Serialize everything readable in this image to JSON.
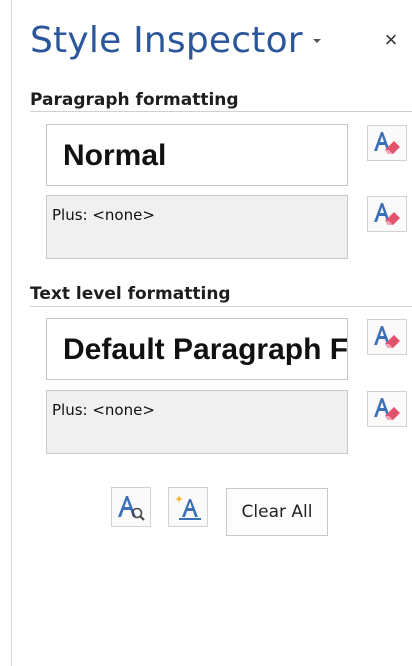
{
  "pane": {
    "title": "Style Inspector",
    "close_label": "×"
  },
  "paragraph": {
    "heading": "Paragraph formatting",
    "style_name": "Normal",
    "plus_text": "Plus: <none>"
  },
  "text_level": {
    "heading": "Text level formatting",
    "style_name": "Default Paragraph Font",
    "plus_text": "Plus: <none>"
  },
  "actions": {
    "clear_all_label": "Clear All",
    "reveal_formatting_icon": "reveal-formatting-icon",
    "new_style_icon": "new-style-icon",
    "clear_formatting_icon": "eraser-icon"
  },
  "colors": {
    "title": "#2b579a",
    "eraser": "#e2536e"
  }
}
